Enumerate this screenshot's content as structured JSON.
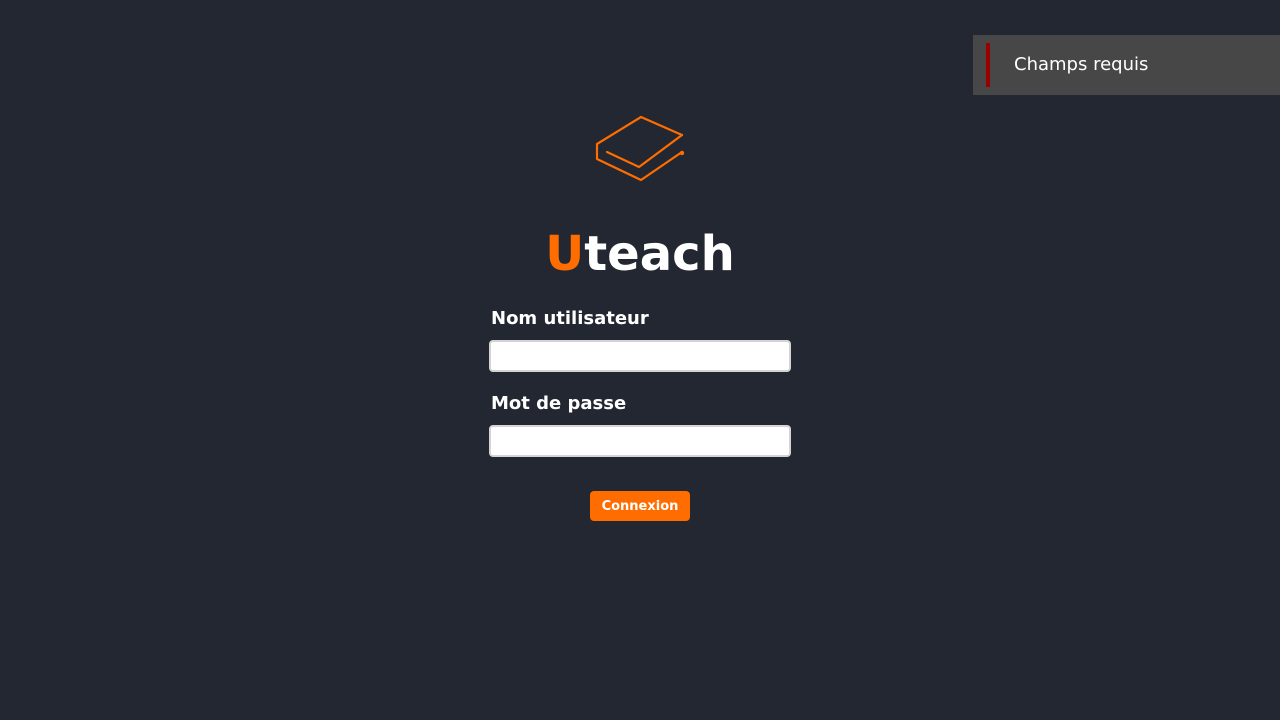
{
  "toast": {
    "message": "Champs requis",
    "accent_color": "#9b0000",
    "icon": "error-bar"
  },
  "brand": {
    "logo_icon": "graduation-cap-icon",
    "name_accent": "U",
    "name_rest": "teach",
    "accent_color": "#ff6d00"
  },
  "form": {
    "username_label": "Nom utilisateur",
    "username_value": "",
    "password_label": "Mot de passe",
    "password_value": "",
    "submit_label": "Connexion"
  },
  "colors": {
    "background": "#222731",
    "button": "#ff6d00",
    "toast_background": "#474747"
  }
}
